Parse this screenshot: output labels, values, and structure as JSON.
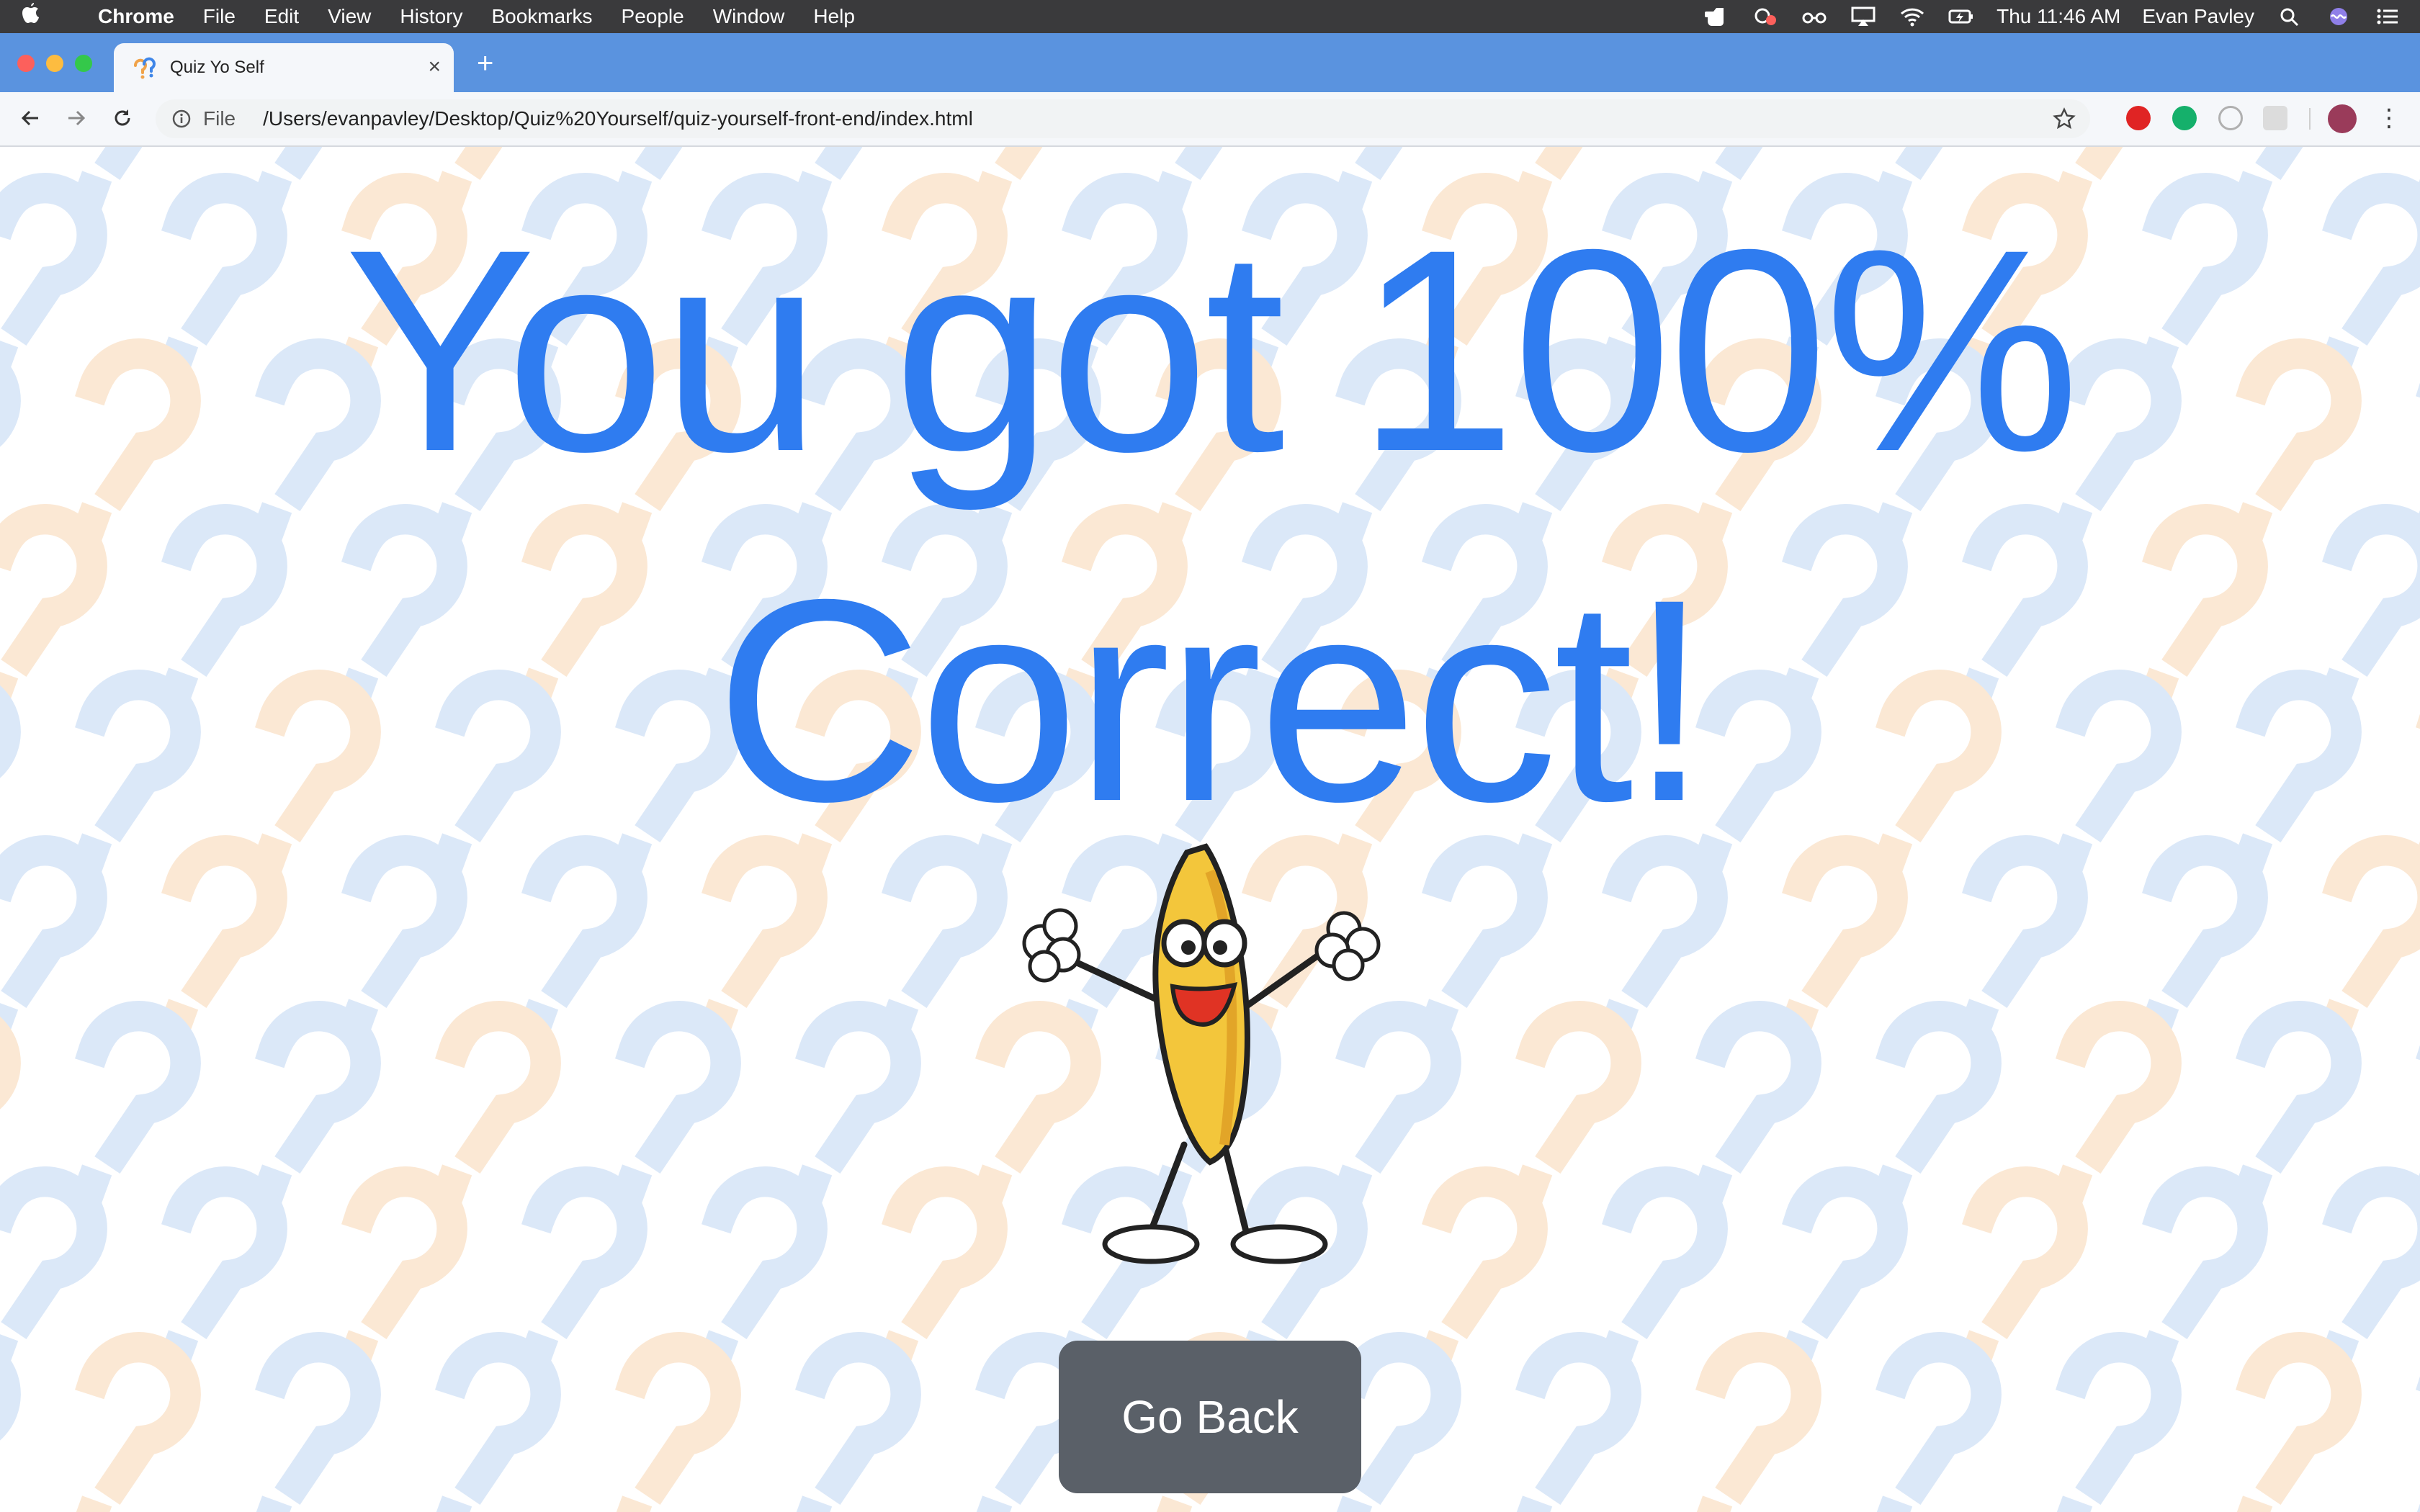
{
  "menubar": {
    "app_name": "Chrome",
    "items": [
      "File",
      "Edit",
      "View",
      "History",
      "Bookmarks",
      "People",
      "Window",
      "Help"
    ],
    "clock": "Thu 11:46 AM",
    "user_name": "Evan Pavley"
  },
  "tab": {
    "title": "Quiz Yo Self",
    "close_glyph": "×",
    "new_tab_glyph": "+"
  },
  "omnibox": {
    "scheme_label": "File",
    "url": "/Users/evanpavley/Desktop/Quiz%20Yourself/quiz-yourself-front-end/index.html"
  },
  "page": {
    "result_text": "You got 100% Correct!",
    "go_back_label": "Go Back"
  },
  "colors": {
    "accent": "#2f7cf0",
    "button": "#5a6068",
    "pattern_blue": "#dbe8f8",
    "pattern_orange": "#fbe8d4",
    "tabstrip": "#5a93df"
  },
  "icons": {
    "apple": "apple-icon",
    "back": "back-arrow-icon",
    "forward": "forward-arrow-icon",
    "reload": "reload-icon",
    "info": "info-icon",
    "star": "bookmark-star-icon",
    "menu": "kebab-menu-icon",
    "mascot": "cheering-banana-image"
  }
}
